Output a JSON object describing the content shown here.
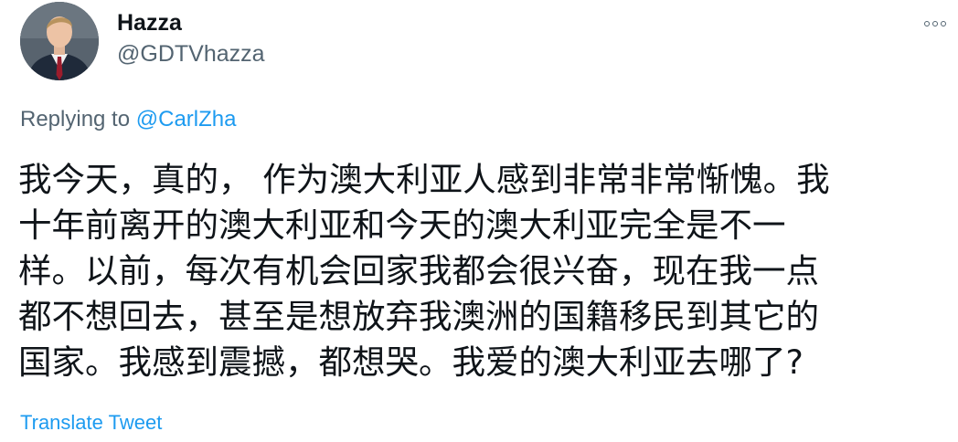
{
  "author": {
    "name": "Hazza",
    "handle": "@GDTVhazza",
    "avatar_icon": "profile-photo"
  },
  "more_icon": "more-options-icon",
  "replying": {
    "prefix": "Replying to",
    "mention": "@CarlZha"
  },
  "tweet": {
    "lines": [
      "我今天，真的， 作为澳大利亚人感到非常非常惭愧。我",
      "十年前离开的澳大利亚和今天的澳大利亚完全是不一",
      "样。以前，每次有机会回家我都会很兴奋，现在我一点",
      "都不想回去，甚至是想放弃我澳洲的国籍移民到其它的",
      "国家。我感到震撼，都想哭。我爱的澳大利亚去哪了?"
    ]
  },
  "translate_label": "Translate Tweet",
  "colors": {
    "link": "#1d9bf0",
    "secondary_text": "#536471",
    "primary_text": "#0f1419"
  }
}
